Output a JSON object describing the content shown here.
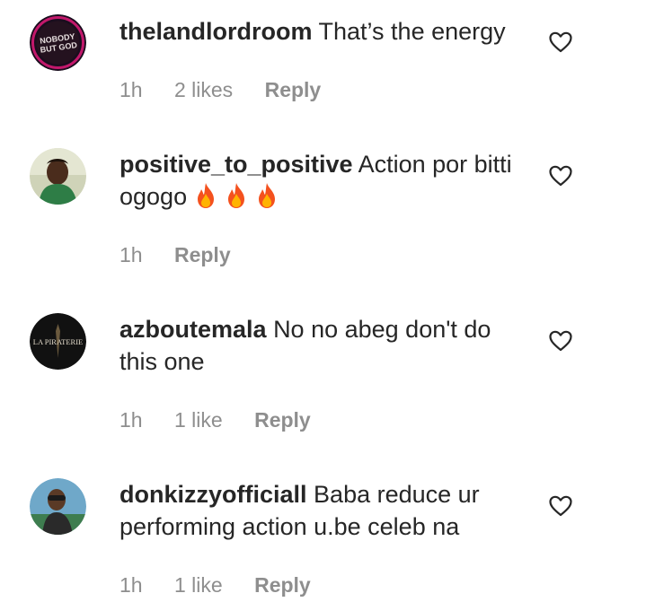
{
  "comments": [
    {
      "username": "thelandlordroom",
      "text": "That’s the energy",
      "time": "1h",
      "likes": "2 likes",
      "reply": "Reply",
      "avatar_text": "NOBODY BUT GOD"
    },
    {
      "username": "positive_to_positive",
      "text": "Action por bitti ogogo",
      "emoji": [
        "fire-emoji",
        "fire-emoji",
        "fire-emoji"
      ],
      "time": "1h",
      "likes": "",
      "reply": "Reply"
    },
    {
      "username": "azboutemala",
      "text": "No no abeg don't do this one",
      "time": "1h",
      "likes": "1 like",
      "reply": "Reply",
      "avatar_text": "LA PIRATERIE"
    },
    {
      "username": "donkizzyofficiall",
      "text": "Baba reduce ur performing action u.be celeb na",
      "time": "1h",
      "likes": "1 like",
      "reply": "Reply"
    }
  ],
  "colors": {
    "text": "#262626",
    "secondary": "#8e8e8e",
    "background": "#ffffff"
  },
  "icons": {
    "like": "heart-outline-icon"
  }
}
